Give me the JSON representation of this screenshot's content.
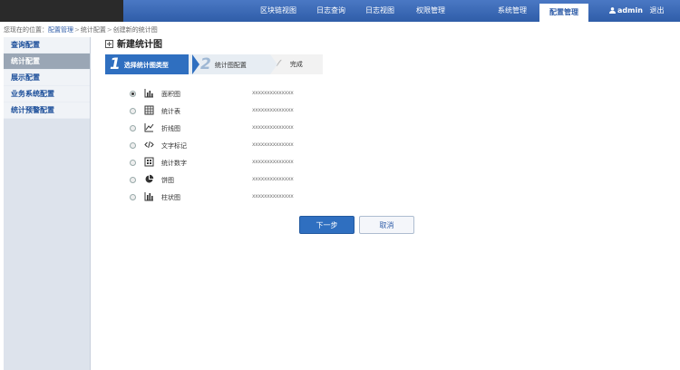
{
  "nav": {
    "items": [
      {
        "label": "区块链视图"
      },
      {
        "label": "日志查询"
      },
      {
        "label": "日志视图"
      },
      {
        "label": "权限管理"
      },
      {
        "label": "系统管理"
      },
      {
        "label": "配置管理",
        "active": true
      }
    ],
    "user": "admin",
    "logout": "退出"
  },
  "breadcrumb": {
    "prefix": "您现在的位置：",
    "items": [
      "配置管理",
      "统计配置",
      "创建新的统计图"
    ]
  },
  "sidebar": {
    "items": [
      {
        "label": "查询配置"
      },
      {
        "label": "统计配置",
        "active": true
      },
      {
        "label": "展示配置"
      },
      {
        "label": "业务系统配置"
      },
      {
        "label": "统计预警配置"
      }
    ]
  },
  "main": {
    "title": "新建统计图",
    "steps": [
      {
        "num": "1",
        "label": "选择统计图类型",
        "state": "active"
      },
      {
        "num": "2",
        "label": "统计图配置",
        "state": "pending"
      },
      {
        "num": "",
        "label": "完成",
        "state": "pending"
      }
    ],
    "types": [
      {
        "icon": "area-chart-icon",
        "label": "面积图",
        "desc": "xxxxxxxxxxxxxx",
        "checked": true
      },
      {
        "icon": "table-icon",
        "label": "统计表",
        "desc": "xxxxxxxxxxxxxx",
        "checked": false
      },
      {
        "icon": "line-chart-icon",
        "label": "折线图",
        "desc": "xxxxxxxxxxxxxx",
        "checked": false
      },
      {
        "icon": "code-icon",
        "label": "文字标记",
        "desc": "xxxxxxxxxxxxxx",
        "checked": false
      },
      {
        "icon": "grid-number-icon",
        "label": "统计数字",
        "desc": "xxxxxxxxxxxxxx",
        "checked": false
      },
      {
        "icon": "pie-chart-icon",
        "label": "饼图",
        "desc": "xxxxxxxxxxxxxx",
        "checked": false
      },
      {
        "icon": "bar-chart-icon",
        "label": "柱状图",
        "desc": "xxxxxxxxxxxxxx",
        "checked": false
      }
    ],
    "next_label": "下一步",
    "cancel_label": "取消"
  }
}
